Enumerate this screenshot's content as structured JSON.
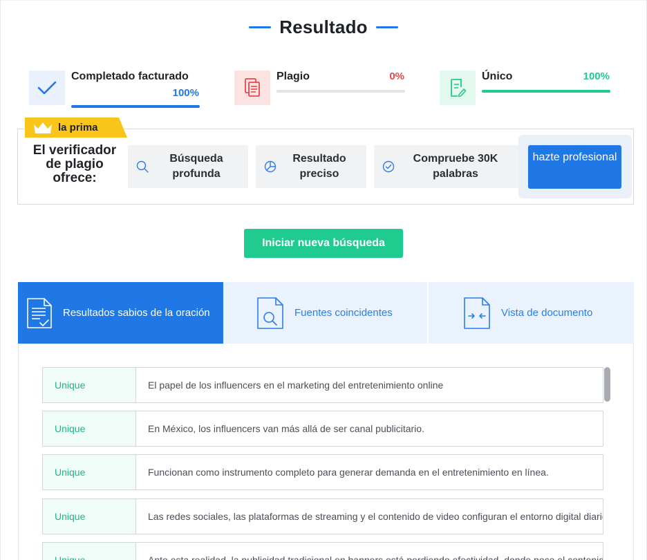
{
  "header": {
    "title": "Resultado"
  },
  "stats": {
    "completed": {
      "label": "Completado facturado",
      "value": "100%",
      "progress": 1.0,
      "color": "#1d78e8",
      "icon": "check-icon"
    },
    "plagio": {
      "label": "Plagio",
      "value": "0%",
      "progress": 0.0,
      "color": "#e8474a",
      "icon": "documents-icon"
    },
    "unico": {
      "label": "Único",
      "value": "100%",
      "progress": 1.0,
      "color": "#1fcb8e",
      "icon": "edit-document-icon"
    }
  },
  "premium": {
    "badge_label": "la prima",
    "badge_icon": "crown-icon",
    "offer_title": "El verificador de plagio ofrece:",
    "features": [
      {
        "label": "Búsqueda profunda",
        "icon": "search-icon"
      },
      {
        "label": "Resultado preciso",
        "icon": "pie-chart-icon"
      },
      {
        "label": "Compruebe 30K palabras",
        "icon": "check-circle-icon"
      }
    ],
    "pro_button": "hazte profesional"
  },
  "new_search_button": "Iniciar nueva búsqueda",
  "tabs": [
    {
      "label": "Resultados sabios de la oración",
      "icon": "document-check-icon",
      "active": true
    },
    {
      "label": "Fuentes coincidentes",
      "icon": "document-search-icon",
      "active": false
    },
    {
      "label": "Vista de documento",
      "icon": "document-compare-icon",
      "active": false
    }
  ],
  "results": [
    {
      "status": "Unique",
      "text": "El papel de los influencers en el marketing del entretenimiento online"
    },
    {
      "status": "Unique",
      "text": "En México, los influencers van más allá de ser canal publicitario."
    },
    {
      "status": "Unique",
      "text": "Funcionan como instrumento completo para generar demanda en el entretenimiento en línea."
    },
    {
      "status": "Unique",
      "text": "Las redes sociales, las plataformas de streaming y el contenido de video configuran el entorno digital diario de millones de personas"
    },
    {
      "status": "Unique",
      "text": "Ante esta realidad, la publicidad tradicional en banners está perdiendo efectividad, donde poco el contenido"
    }
  ],
  "colors": {
    "accent": "#1f78e6",
    "success": "#1fcb8e",
    "danger": "#e8474a",
    "premium": "#f9c51a"
  }
}
